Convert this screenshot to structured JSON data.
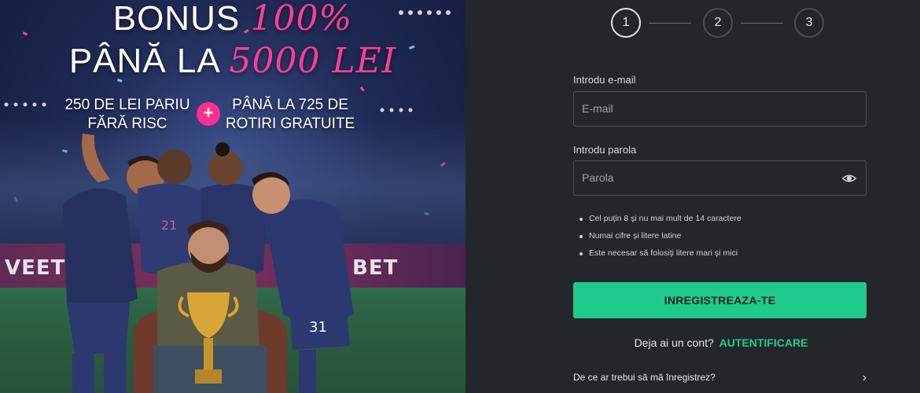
{
  "promo": {
    "headline_line1_white": "BONUS",
    "headline_line1_pink": "100%",
    "headline_line2_white": "PÂNĂ LA",
    "headline_line2_pink": "5000 LEI",
    "offer_left": "250 DE LEI PARIU FĂRĂ RISC",
    "plus_symbol": "+",
    "offer_right": "PÂNĂ LA 725 DE ROTIRI GRATUITE",
    "ad_board_left": "VEET",
    "ad_board_right": "BET",
    "jersey_numbers": [
      "21",
      "31"
    ],
    "accent_color": "#ff3d9a"
  },
  "stepper": {
    "steps": [
      "1",
      "2",
      "3"
    ],
    "active_step": 1
  },
  "form": {
    "email_label": "Introdu e-mail",
    "email_placeholder": "E-mail",
    "email_value": "",
    "password_label": "Introdu parola",
    "password_placeholder": "Parola",
    "password_value": "",
    "password_toggle_icon": "eye-icon",
    "rules": [
      "Cel puțin 8 și nu mai mult de 14 caractere",
      "Numai cifre și litere latine",
      "Este necesar să folosiți litere mari și mici"
    ],
    "register_label": "INREGISTREAZA-TE",
    "register_color": "#1fcb8c",
    "have_account_text": "Deja ai un cont?",
    "login_link": "AUTENTIFICARE",
    "why_register": "De ce ar trebui să mă înregistrez?",
    "why_icon": "chevron-right-icon"
  }
}
